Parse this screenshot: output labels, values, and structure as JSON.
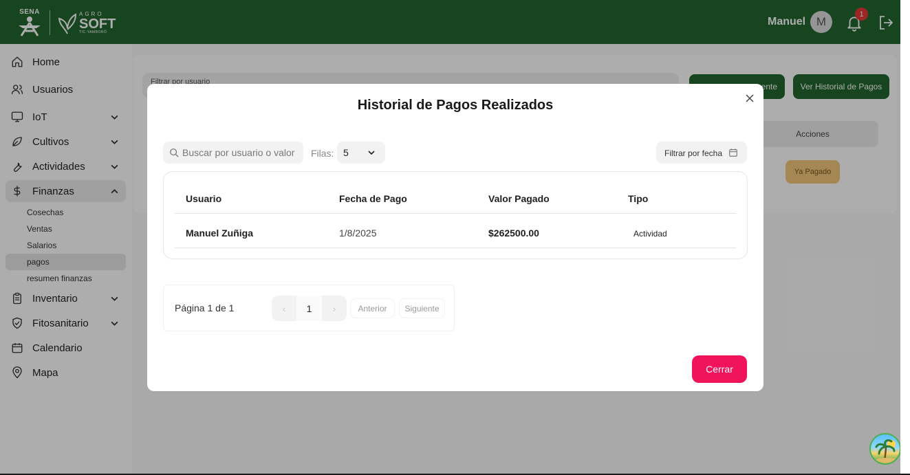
{
  "header": {
    "brand_sena": "SENA",
    "brand_agro_small": "AGRO",
    "brand_agro_big": "SOFT",
    "brand_agro_tiny": "TIC·YAMBORÓ",
    "user_name": "Manuel",
    "avatar_initial": "M",
    "notifications_count": "1",
    "header_color": "#23662f"
  },
  "sidebar": {
    "items": [
      {
        "label": "Home",
        "icon": "home-icon"
      },
      {
        "label": "Usuarios",
        "icon": "users-icon"
      },
      {
        "label": "IoT",
        "icon": "monitor-icon"
      },
      {
        "label": "Cultivos",
        "icon": "leaf-icon"
      },
      {
        "label": "Actividades",
        "icon": "wrench-icon"
      },
      {
        "label": "Finanzas",
        "icon": "dollar-icon"
      },
      {
        "label": "Inventario",
        "icon": "clipboard-icon"
      },
      {
        "label": "Fitosanitario",
        "icon": "shield-icon"
      },
      {
        "label": "Calendario",
        "icon": "calendar-icon"
      },
      {
        "label": "Mapa",
        "icon": "map-pin-icon"
      }
    ],
    "finanzas_sub": [
      {
        "label": "Cosechas"
      },
      {
        "label": "Ventas"
      },
      {
        "label": "Salarios"
      },
      {
        "label": "pagos"
      },
      {
        "label": "resumen finanzas"
      }
    ]
  },
  "background": {
    "filter_placeholder": "Filtrar por usuario",
    "btn_pending": "ente",
    "btn_history": "Ver Historial de Pagos",
    "th_actions": "Acciones",
    "paid_badge": "Ya Pagado"
  },
  "modal": {
    "title": "Historial de Pagos Realizados",
    "search_placeholder": "Buscar por usuario o valor",
    "rows_label": "Filas:",
    "rows_value": "5",
    "date_filter": "Filtrar por fecha",
    "columns": [
      "Usuario",
      "Fecha de Pago",
      "Valor Pagado",
      "Tipo"
    ],
    "rows": [
      {
        "usuario": "Manuel Zuñiga",
        "fecha": "1/8/2025",
        "valor": "$262500.00",
        "tipo": "Actividad"
      }
    ],
    "page_info": "Página 1 de 1",
    "page_prev_glyph": "‹",
    "current_page": "1",
    "page_next_glyph": "›",
    "prev_label": "Anterior",
    "next_label": "Siguiente",
    "close_label": "Cerrar",
    "accent_color": "#f0145a"
  }
}
